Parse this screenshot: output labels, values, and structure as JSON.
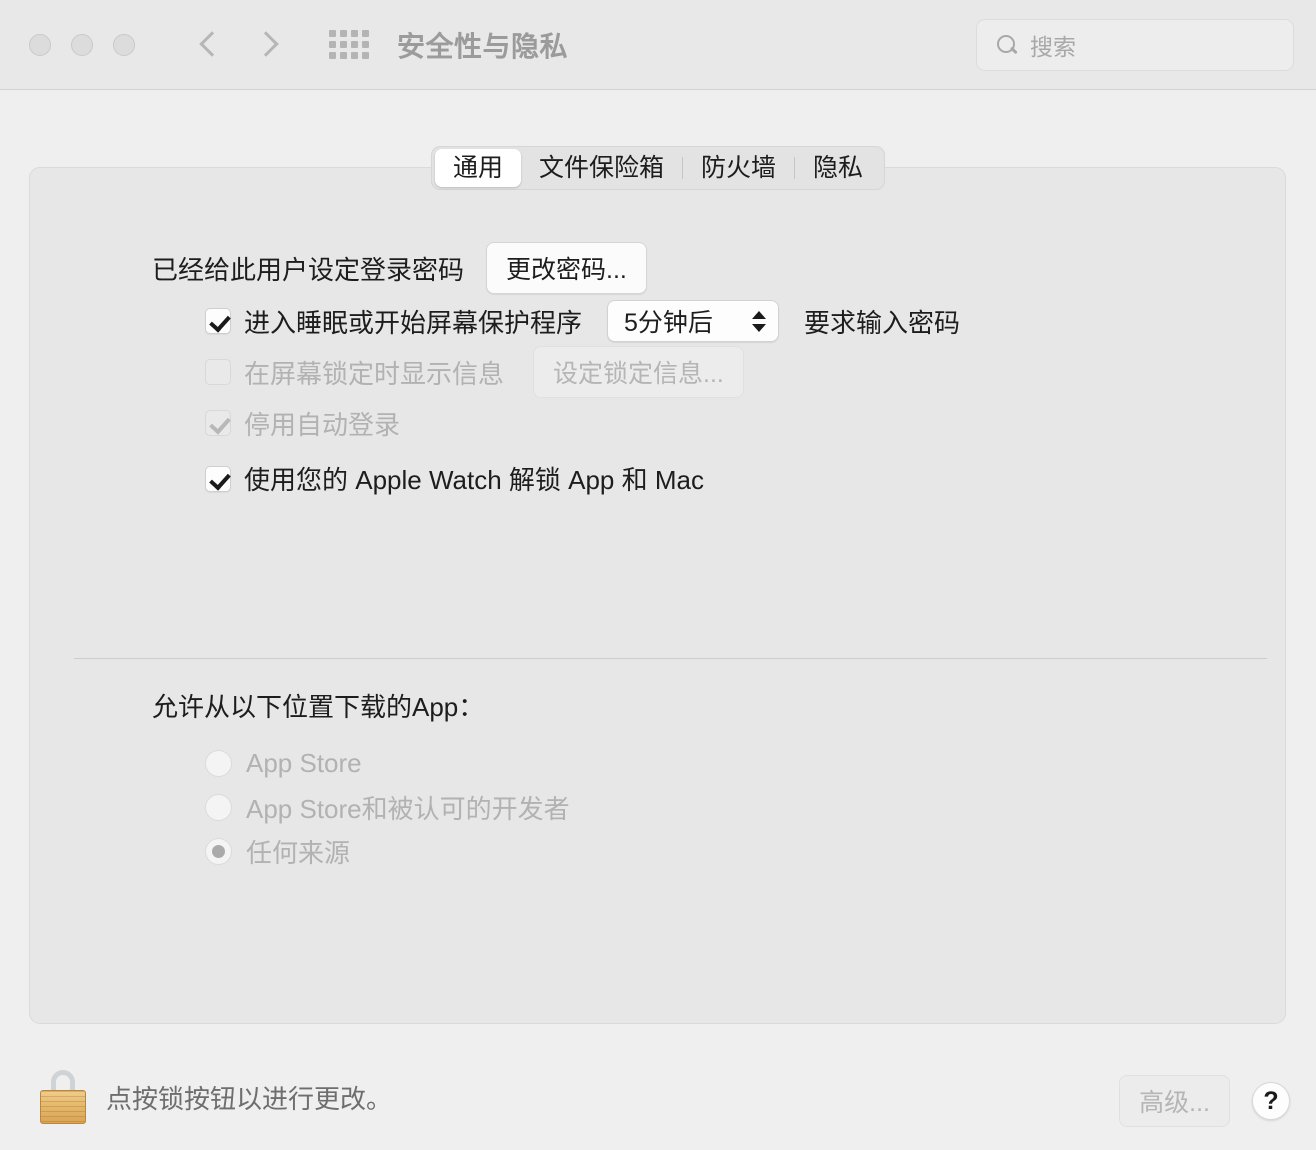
{
  "window": {
    "title": "安全性与隐私",
    "traffic_lights": [
      "close",
      "minimize",
      "zoom"
    ],
    "back_label": "后退",
    "forward_label": "前进",
    "show_all_label": "显示全部"
  },
  "search": {
    "placeholder": "搜索",
    "value": ""
  },
  "tabs": [
    {
      "label": "通用",
      "active": true
    },
    {
      "label": "文件保险箱",
      "active": false
    },
    {
      "label": "防火墙",
      "active": false
    },
    {
      "label": "隐私",
      "active": false
    }
  ],
  "general": {
    "password_status": "已经给此用户设定登录密码",
    "change_password_button": "更改密码...",
    "checkboxes": [
      {
        "label": "进入睡眠或开始屏幕保护程序",
        "checked": true,
        "enabled": true,
        "popup_value": "5分钟后",
        "suffix": "要求输入密码"
      },
      {
        "label": "在屏幕锁定时显示信息",
        "checked": false,
        "enabled": false,
        "button": "设定锁定信息..."
      },
      {
        "label": "停用自动登录",
        "checked": true,
        "enabled": false
      },
      {
        "label": "使用您的 Apple Watch 解锁 App 和 Mac",
        "checked": true,
        "enabled": true
      }
    ],
    "download_section": {
      "title": "允许从以下位置下载的App：",
      "options": [
        {
          "label": "App Store",
          "selected": false,
          "enabled": false
        },
        {
          "label": "App Store和被认可的开发者",
          "selected": false,
          "enabled": false
        },
        {
          "label": "任何来源",
          "selected": true,
          "enabled": false
        }
      ]
    }
  },
  "bottom": {
    "lock_state": "locked",
    "lock_message": "点按锁按钮以进行更改。",
    "advanced_button": "高级...",
    "help_button": "?"
  },
  "colors": {
    "toolbar_bg": "#e8e8e8",
    "body_bg": "#efefef",
    "panel_bg": "#e7e7e7",
    "text": "#1d1d1d",
    "disabled_text": "#b2b2b2",
    "title_text": "#9b9b9b"
  }
}
